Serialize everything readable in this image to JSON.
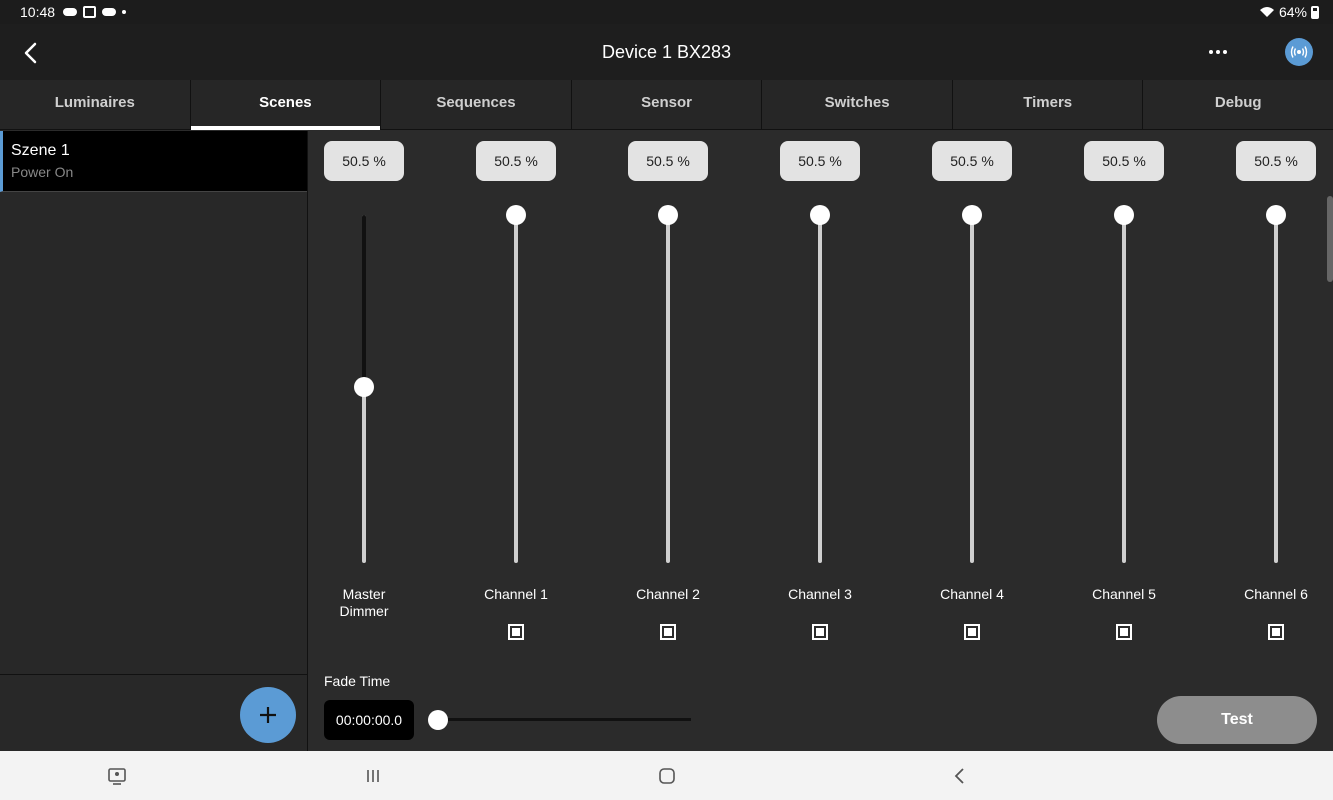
{
  "status_bar": {
    "time": "10:48",
    "battery": "64%"
  },
  "header": {
    "title": "Device 1 BX283",
    "back_icon": "chevron-left-icon",
    "more_icon": "more-horizontal-icon",
    "broadcast_icon": "broadcast-icon",
    "accent_color": "#5b9bd5"
  },
  "tabs": [
    {
      "label": "Luminaires",
      "active": false
    },
    {
      "label": "Scenes",
      "active": true
    },
    {
      "label": "Sequences",
      "active": false
    },
    {
      "label": "Sensor",
      "active": false
    },
    {
      "label": "Switches",
      "active": false
    },
    {
      "label": "Timers",
      "active": false
    },
    {
      "label": "Debug",
      "active": false
    }
  ],
  "scene_list": {
    "items": [
      {
        "name": "Szene 1",
        "subtitle": "Power On",
        "selected": true
      }
    ],
    "add_icon": "plus-icon"
  },
  "channels": [
    {
      "value": "50.5 %",
      "label_line1": "Master",
      "label_line2": "Dimmer",
      "level": 0.505,
      "checkbox": false
    },
    {
      "value": "50.5 %",
      "label_line1": "Channel 1",
      "label_line2": "",
      "level": 1.0,
      "checkbox": true
    },
    {
      "value": "50.5 %",
      "label_line1": "Channel 2",
      "label_line2": "",
      "level": 1.0,
      "checkbox": true
    },
    {
      "value": "50.5 %",
      "label_line1": "Channel 3",
      "label_line2": "",
      "level": 1.0,
      "checkbox": true
    },
    {
      "value": "50.5 %",
      "label_line1": "Channel 4",
      "label_line2": "",
      "level": 1.0,
      "checkbox": true
    },
    {
      "value": "50.5 %",
      "label_line1": "Channel 5",
      "label_line2": "",
      "level": 1.0,
      "checkbox": true
    },
    {
      "value": "50.5 %",
      "label_line1": "Channel 6",
      "label_line2": "",
      "level": 1.0,
      "checkbox": true
    }
  ],
  "fade": {
    "label": "Fade Time",
    "value": "00:00:00.0",
    "level": 0.0
  },
  "test_button": {
    "label": "Test"
  },
  "nav_bar": {
    "recents_icon": "recent-apps-icon",
    "home_icon": "home-icon",
    "back_icon": "back-icon",
    "screen_icon": "screen-share-icon"
  }
}
